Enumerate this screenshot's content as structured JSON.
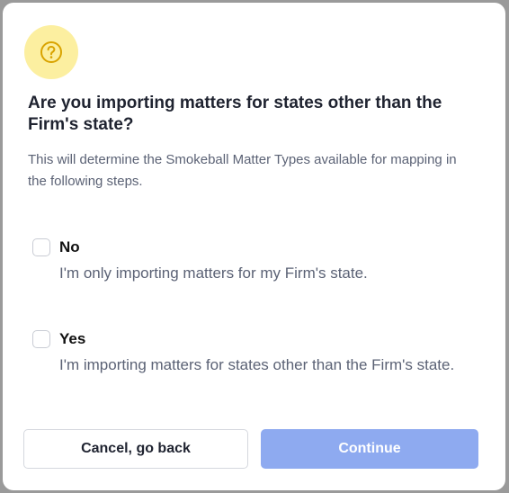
{
  "dialog": {
    "icon": "question-circle-icon",
    "title": "Are you importing matters for states other than the Firm's state?",
    "subtitle": "This will determine the Smokeball Matter Types available for mapping in the following steps.",
    "options": [
      {
        "label": "No",
        "description": "I'm only importing matters for my Firm's state.",
        "checked": false
      },
      {
        "label": "Yes",
        "description": "I'm importing matters for states other than the Firm's state.",
        "checked": false
      }
    ],
    "buttons": {
      "cancel_label": "Cancel, go back",
      "continue_label": "Continue"
    }
  },
  "colors": {
    "icon_bg": "#fcefa0",
    "icon_fg": "#d9a300",
    "continue_bg": "#8eaaf0",
    "title_text": "#1f2330",
    "muted_text": "#5b6275"
  }
}
